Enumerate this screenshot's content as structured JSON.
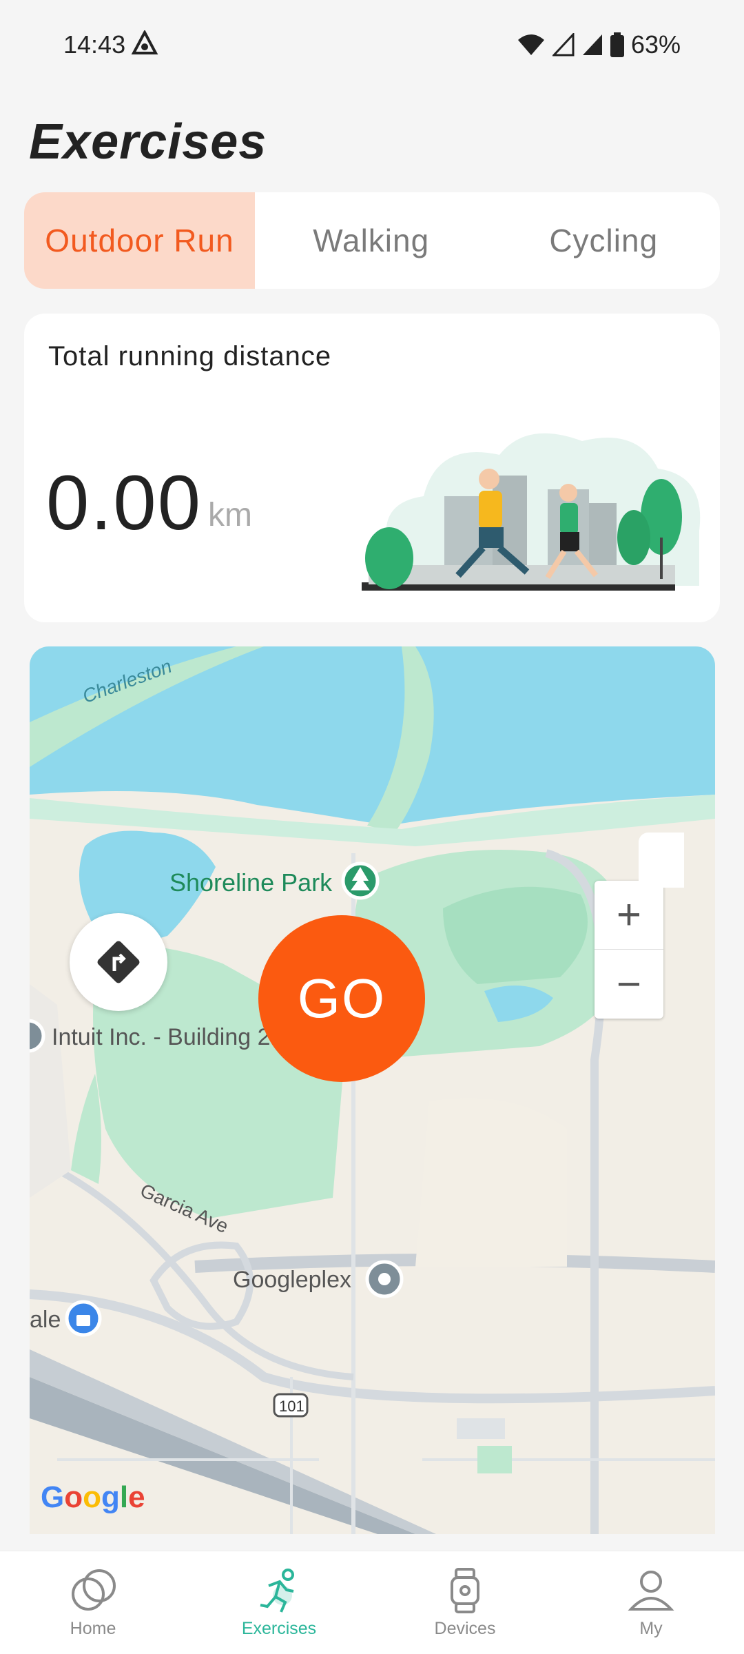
{
  "status_bar": {
    "time": "14:43",
    "battery_percent": "63%",
    "icons": [
      "navigation-glyph-icon",
      "wifi-icon",
      "signal-icon",
      "signal-icon",
      "battery-icon"
    ]
  },
  "page": {
    "title": "Exercises"
  },
  "tabs": [
    {
      "label": "Outdoor Run",
      "active": true
    },
    {
      "label": "Walking",
      "active": false
    },
    {
      "label": "Cycling",
      "active": false
    }
  ],
  "distance_card": {
    "label": "Total running distance",
    "value": "0.00",
    "unit": "km"
  },
  "map": {
    "labels": {
      "water": "Charleston",
      "park": "Shoreline Park",
      "building": "Intuit Inc. - Building 20",
      "road": "Garcia Ave",
      "place": "Googleplex",
      "shop_fragment": "ale",
      "highway": "101"
    },
    "go_label": "GO",
    "zoom_in_label": "+",
    "zoom_out_label": "−",
    "attribution": "Google"
  },
  "bottom_nav": [
    {
      "label": "Home",
      "icon": "home-circles-icon",
      "active": false
    },
    {
      "label": "Exercises",
      "icon": "runner-icon",
      "active": true
    },
    {
      "label": "Devices",
      "icon": "watch-icon",
      "active": false
    },
    {
      "label": "My",
      "icon": "person-icon",
      "active": false
    }
  ],
  "colors": {
    "accent": "#fb5a10",
    "active_tab_bg": "#fcd9c9",
    "active_tab_text": "#f25a1f",
    "nav_active": "#2bb69a",
    "water": "#8ed8ec",
    "park": "#bde8cf"
  }
}
